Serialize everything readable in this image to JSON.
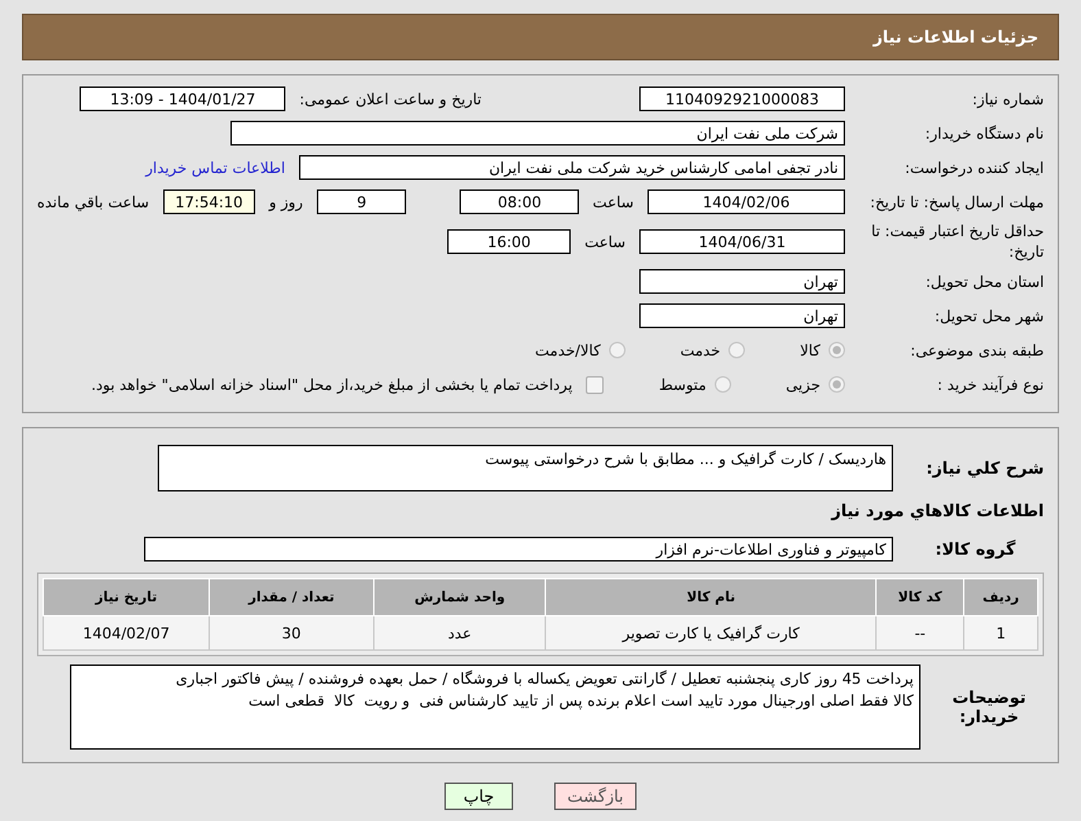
{
  "header": {
    "title": "جزئیات اطلاعات نیاز"
  },
  "need_number": {
    "label": "شماره نیاز:",
    "value": "1104092921000083"
  },
  "announce": {
    "label": "تاریخ و ساعت اعلان عمومی:",
    "value": "1404/01/27 - 13:09"
  },
  "buyer": {
    "label": "نام دستگاه خریدار:",
    "value": "شرکت ملی نفت ایران"
  },
  "creator": {
    "label": "ایجاد کننده درخواست:",
    "value": "نادر تجفی امامی کارشناس خرید شرکت ملی نفت ایران",
    "link": "اطلاعات تماس خریدار"
  },
  "deadline": {
    "label": "مهلت ارسال پاسخ: تا تاریخ:",
    "date": "1404/02/06",
    "time_label": "ساعت",
    "time": "08:00",
    "days": "9",
    "days_label": "روز و",
    "remaining": "17:54:10",
    "remaining_label": "ساعت باقي مانده"
  },
  "validity": {
    "label": "حداقل تاریخ اعتبار قیمت: تا تاریخ:",
    "date": "1404/06/31",
    "time_label": "ساعت",
    "time": "16:00"
  },
  "province": {
    "label": "استان محل تحویل:",
    "value": "تهران"
  },
  "city": {
    "label": "شهر محل تحویل:",
    "value": "تهران"
  },
  "category": {
    "label": "طبقه بندی موضوعی:",
    "options": [
      {
        "label": "کالا",
        "selected": true
      },
      {
        "label": "خدمت",
        "selected": false
      },
      {
        "label": "کالا/خدمت",
        "selected": false
      }
    ]
  },
  "purchase_type": {
    "label": "نوع فرآیند خرید :",
    "options": [
      {
        "label": "جزیی",
        "selected": true
      },
      {
        "label": "متوسط",
        "selected": false
      }
    ],
    "payment": {
      "checked": false,
      "text": "پرداخت تمام یا بخشی از مبلغ خرید،از محل \"اسناد خزانه اسلامی\" خواهد بود."
    }
  },
  "description": {
    "label": "شرح کلي نیاز:",
    "value": "هاردیسک / کارت گرافیک و ... مطابق با شرح درخواستی پیوست"
  },
  "goods_heading": "اطلاعات کالاهاي مورد نیاز",
  "goods_group": {
    "label": "گروه کالا:",
    "value": "کامپیوتر و فناوری اطلاعات-نرم افزار"
  },
  "table": {
    "columns": [
      "ردیف",
      "کد کالا",
      "نام کالا",
      "واحد شمارش",
      "تعداد / مقدار",
      "تاریخ نیاز"
    ],
    "rows": [
      [
        "1",
        "--",
        "کارت گرافیک یا کارت تصویر",
        "عدد",
        "30",
        "1404/02/07"
      ]
    ]
  },
  "notes": {
    "label": "توضیحات خریدار:",
    "value": "پرداخت 45 روز کاری پنجشنبه تعطیل / گارانتی تعویض یکساله با فروشگاه / حمل بعهده فروشنده / پیش فاکتور اجباری\nکالا فقط اصلی اورجینال مورد تایید است اعلام برنده پس از تایید کارشناس فنی  و رویت  کالا  قطعی است"
  },
  "buttons": [
    {
      "kind": "back",
      "label": "بازگشت"
    },
    {
      "kind": "print",
      "label": "چاپ"
    }
  ]
}
